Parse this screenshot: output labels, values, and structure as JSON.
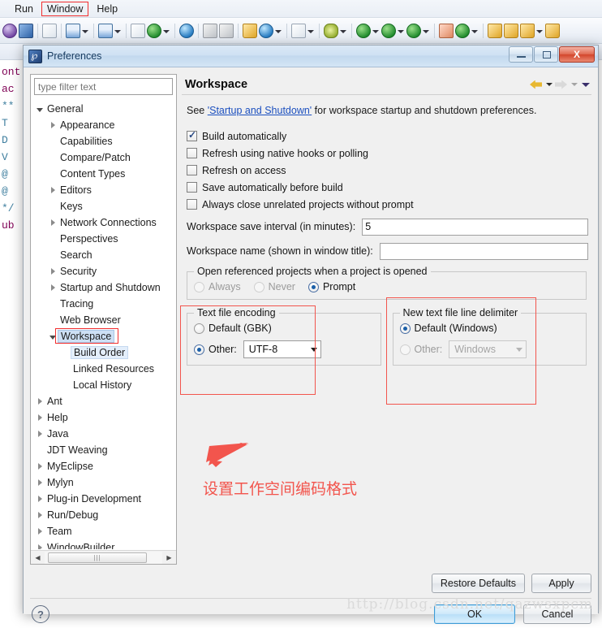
{
  "app": {
    "menubar": [
      {
        "label": "Run",
        "highlighted": false
      },
      {
        "label": "Window",
        "highlighted": true
      },
      {
        "label": "Help",
        "highlighted": false
      }
    ],
    "editor_code_lines": [
      "ont",
      "ac",
      "",
      "**",
      "T",
      "D",
      "V",
      "@",
      "@",
      "*/",
      "ub"
    ]
  },
  "dialog": {
    "title": "Preferences",
    "title_icon": "preferences-icon",
    "window_buttons": {
      "minimize": "minimize-button",
      "maximize": "maximize-button",
      "close": "X"
    },
    "filter": {
      "placeholder": "type filter text",
      "value": ""
    },
    "tree": [
      {
        "label": "General",
        "indent": 0,
        "twisty": "expanded",
        "state": "normal"
      },
      {
        "label": "Appearance",
        "indent": 1,
        "twisty": "collapsed",
        "state": "normal"
      },
      {
        "label": "Capabilities",
        "indent": 1,
        "twisty": "none",
        "state": "normal"
      },
      {
        "label": "Compare/Patch",
        "indent": 1,
        "twisty": "none",
        "state": "normal"
      },
      {
        "label": "Content Types",
        "indent": 1,
        "twisty": "none",
        "state": "normal"
      },
      {
        "label": "Editors",
        "indent": 1,
        "twisty": "collapsed",
        "state": "normal"
      },
      {
        "label": "Keys",
        "indent": 1,
        "twisty": "none",
        "state": "normal"
      },
      {
        "label": "Network Connections",
        "indent": 1,
        "twisty": "collapsed",
        "state": "normal"
      },
      {
        "label": "Perspectives",
        "indent": 1,
        "twisty": "none",
        "state": "normal"
      },
      {
        "label": "Search",
        "indent": 1,
        "twisty": "none",
        "state": "normal"
      },
      {
        "label": "Security",
        "indent": 1,
        "twisty": "collapsed",
        "state": "normal"
      },
      {
        "label": "Startup and Shutdown",
        "indent": 1,
        "twisty": "collapsed",
        "state": "normal"
      },
      {
        "label": "Tracing",
        "indent": 1,
        "twisty": "none",
        "state": "normal"
      },
      {
        "label": "Web Browser",
        "indent": 1,
        "twisty": "none",
        "state": "normal"
      },
      {
        "label": "Workspace",
        "indent": 1,
        "twisty": "expanded",
        "state": "selected"
      },
      {
        "label": "Build Order",
        "indent": 2,
        "twisty": "none",
        "state": "selected2"
      },
      {
        "label": "Linked Resources",
        "indent": 2,
        "twisty": "none",
        "state": "normal"
      },
      {
        "label": "Local History",
        "indent": 2,
        "twisty": "none",
        "state": "normal"
      },
      {
        "label": "Ant",
        "indent": 0,
        "twisty": "collapsed",
        "state": "normal"
      },
      {
        "label": "Help",
        "indent": 0,
        "twisty": "collapsed",
        "state": "normal"
      },
      {
        "label": "Java",
        "indent": 0,
        "twisty": "collapsed",
        "state": "normal"
      },
      {
        "label": "JDT Weaving",
        "indent": 0,
        "twisty": "none",
        "state": "normal"
      },
      {
        "label": "MyEclipse",
        "indent": 0,
        "twisty": "collapsed",
        "state": "normal"
      },
      {
        "label": "Mylyn",
        "indent": 0,
        "twisty": "collapsed",
        "state": "normal"
      },
      {
        "label": "Plug-in Development",
        "indent": 0,
        "twisty": "collapsed",
        "state": "normal"
      },
      {
        "label": "Run/Debug",
        "indent": 0,
        "twisty": "collapsed",
        "state": "normal"
      },
      {
        "label": "Team",
        "indent": 0,
        "twisty": "collapsed",
        "state": "normal"
      },
      {
        "label": "WindowBuilder",
        "indent": 0,
        "twisty": "collapsed",
        "state": "normal"
      }
    ],
    "page": {
      "title": "Workspace",
      "nav": {
        "back": "back-arrow",
        "forward": "forward-arrow"
      },
      "see_prefix": "See ",
      "see_link": "'Startup and Shutdown'",
      "see_suffix": " for workspace startup and shutdown preferences.",
      "checkboxes": [
        {
          "label": "Build automatically",
          "checked": true
        },
        {
          "label": "Refresh using native hooks or polling",
          "checked": false
        },
        {
          "label": "Refresh on access",
          "checked": false
        },
        {
          "label": "Save automatically before build",
          "checked": false
        },
        {
          "label": "Always close unrelated projects without prompt",
          "checked": false
        }
      ],
      "save_interval": {
        "label": "Workspace save interval (in minutes):",
        "value": "5"
      },
      "workspace_name": {
        "label": "Workspace name (shown in window title):",
        "value": ""
      },
      "open_referenced": {
        "legend": "Open referenced projects when a project is opened",
        "options": [
          {
            "label": "Always",
            "selected": false
          },
          {
            "label": "Never",
            "selected": false
          },
          {
            "label": "Prompt",
            "selected": true
          }
        ]
      },
      "text_file_encoding": {
        "legend": "Text file encoding",
        "default_label": "Default (GBK)",
        "default_selected": false,
        "other_label": "Other:",
        "other_selected": true,
        "other_value": "UTF-8"
      },
      "line_delimiter": {
        "legend": "New text file line delimiter",
        "default_label": "Default (Windows)",
        "default_selected": true,
        "other_label": "Other:",
        "other_selected": false,
        "other_value": "Windows"
      },
      "annotation_text": "设置工作空间编码格式",
      "restore_defaults_label": "Restore Defaults",
      "apply_label": "Apply"
    },
    "footer": {
      "help_icon": "?",
      "ok_label": "OK",
      "cancel_label": "Cancel"
    }
  },
  "watermark": "http://blog.csdn.net/qazwsxpcm",
  "colors": {
    "accent_red": "#f2554d",
    "link_blue": "#1b4fbf",
    "selection_blue": "#cde0f5",
    "title_blue": "#14395e"
  }
}
